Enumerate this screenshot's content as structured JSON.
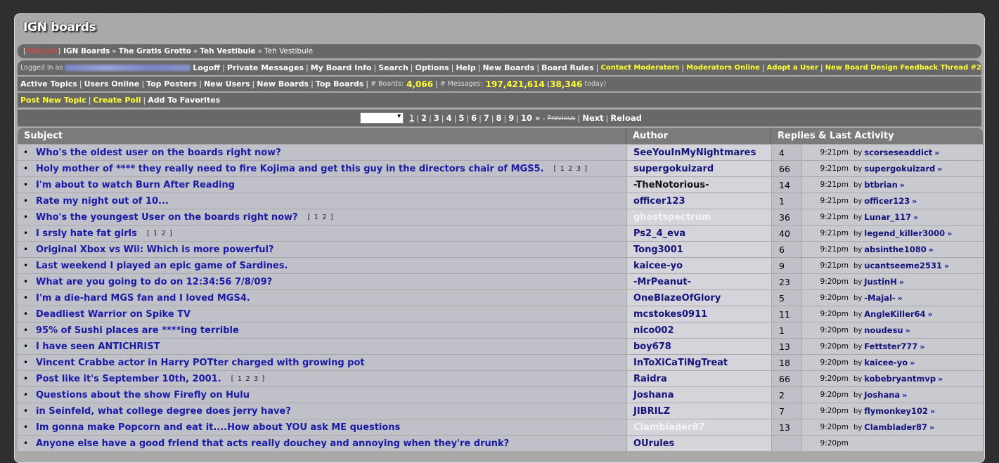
{
  "logo": "IGN boards",
  "breadcrumb": {
    "site": "IGN.com",
    "boards": "IGN Boards",
    "sep": "»",
    "group": "The Gratis Grotto",
    "board": "Teh Vestibule",
    "current": "Teh Vestibule"
  },
  "userbar": {
    "logged_in_as": "Logged in as",
    "items": [
      "Logoff",
      "Private Messages",
      "My Board Info",
      "Search",
      "Options",
      "Help",
      "New Boards",
      "Board Rules"
    ],
    "yellow_items": [
      "Contact Moderators",
      "Moderators Online",
      "Adopt a User",
      "New Board Design Feedback Thread #2"
    ]
  },
  "statsbar": {
    "items": [
      "Active Topics",
      "Users Online",
      "Top Posters",
      "New Users",
      "New Boards",
      "Top Boards"
    ],
    "boards_label": "# Boards:",
    "boards_count": "4,066",
    "messages_label": "# Messages:",
    "messages_count": "197,421,614",
    "today_open": "(",
    "today_count": "38,346",
    "today_label": "today)"
  },
  "actionbar": {
    "post_new_topic": "Post New Topic",
    "create_poll": "Create Poll",
    "add_favorites": "Add To Favorites"
  },
  "pagination": {
    "pages": [
      "1",
      "2",
      "3",
      "4",
      "5",
      "6",
      "7",
      "8",
      "9",
      "10"
    ],
    "more": "»",
    "dash": "-",
    "previous": "Previous",
    "next": "Next",
    "reload": "Reload"
  },
  "table": {
    "headers": {
      "subject": "Subject",
      "author": "Author",
      "replies": "Replies & Last Activity"
    },
    "by_label": "by",
    "arrow": "»",
    "rows": [
      {
        "subject": "Who's the oldest user on the boards right now?",
        "pages": "",
        "author": "SeeYouInMyNightmares",
        "author_style": "",
        "replies": "4",
        "time": "9:21pm",
        "last_user": "scorseseaddict"
      },
      {
        "subject": "Holy mother of **** they really need to fire Kojima and get this guy in the directors chair of MGS5.",
        "pages": "[ 1 2 3 ]",
        "author": "supergokuizard",
        "author_style": "",
        "replies": "66",
        "time": "9:21pm",
        "last_user": "supergokuizard"
      },
      {
        "subject": "I'm about to watch Burn After Reading",
        "pages": "",
        "author": "-TheNotorious-",
        "author_style": "black",
        "replies": "14",
        "time": "9:21pm",
        "last_user": "btbrian"
      },
      {
        "subject": "Rate my night out of 10...",
        "pages": "",
        "author": "officer123",
        "author_style": "",
        "replies": "1",
        "time": "9:21pm",
        "last_user": "officer123"
      },
      {
        "subject": "Who's the youngest User on the boards right now?",
        "pages": "[ 1 2 ]",
        "author": "ghostspectrum",
        "author_style": "white",
        "replies": "36",
        "time": "9:21pm",
        "last_user": "Lunar_117"
      },
      {
        "subject": "I srsly hate fat girls",
        "pages": "[ 1 2 ]",
        "author": "Ps2_4_eva",
        "author_style": "",
        "replies": "40",
        "time": "9:21pm",
        "last_user": "legend_killer3000"
      },
      {
        "subject": "Original Xbox vs Wii: Which is more powerful?",
        "pages": "",
        "author": "Tong3001",
        "author_style": "",
        "replies": "6",
        "time": "9:21pm",
        "last_user": "absinthe1080"
      },
      {
        "subject": "Last weekend I played an epic game of Sardines.",
        "pages": "",
        "author": "kaicee-yo",
        "author_style": "",
        "replies": "9",
        "time": "9:21pm",
        "last_user": "ucantseeme2531"
      },
      {
        "subject": "What are you going to do on 12:34:56 7/8/09?",
        "pages": "",
        "author": "-MrPeanut-",
        "author_style": "",
        "replies": "23",
        "time": "9:20pm",
        "last_user": "JustinH"
      },
      {
        "subject": "I'm a die-hard MGS fan and I loved MGS4.",
        "pages": "",
        "author": "OneBlazeOfGlory",
        "author_style": "",
        "replies": "5",
        "time": "9:20pm",
        "last_user": "-Majal-"
      },
      {
        "subject": "Deadliest Warrior on Spike TV",
        "pages": "",
        "author": "mcstokes0911",
        "author_style": "",
        "replies": "11",
        "time": "9:20pm",
        "last_user": "AngleKiller64"
      },
      {
        "subject": "95% of Sushi places are ****ing terrible",
        "pages": "",
        "author": "nico002",
        "author_style": "",
        "replies": "1",
        "time": "9:20pm",
        "last_user": "noudesu"
      },
      {
        "subject": "I have seen ANTICHRIST",
        "pages": "",
        "author": "boy678",
        "author_style": "",
        "replies": "13",
        "time": "9:20pm",
        "last_user": "Fettster777"
      },
      {
        "subject": "Vincent Crabbe actor in Harry POTter charged with growing pot",
        "pages": "",
        "author": "InToXiCaTiNgTreat",
        "author_style": "",
        "replies": "18",
        "time": "9:20pm",
        "last_user": "kaicee-yo"
      },
      {
        "subject": "Post like it's September 10th, 2001.",
        "pages": "[ 1 2 3 ]",
        "author": "Raidra",
        "author_style": "",
        "replies": "66",
        "time": "9:20pm",
        "last_user": "kobebryantmvp"
      },
      {
        "subject": "Questions about the show Firefly on Hulu",
        "pages": "",
        "author": "Joshana",
        "author_style": "",
        "replies": "2",
        "time": "9:20pm",
        "last_user": "Joshana"
      },
      {
        "subject": "in Seinfeld, what college degree does jerry have?",
        "pages": "",
        "author": "JIBRILZ",
        "author_style": "",
        "replies": "7",
        "time": "9:20pm",
        "last_user": "flymonkey102"
      },
      {
        "subject": "Im gonna make Popcorn and eat it....How about YOU ask ME questions",
        "pages": "",
        "author": "Clamblader87",
        "author_style": "white",
        "replies": "13",
        "time": "9:20pm",
        "last_user": "Clamblader87"
      },
      {
        "subject": "Anyone else have a good friend that acts really douchey and annoying when they're drunk?",
        "pages": "",
        "author": "OUrules",
        "author_style": "",
        "replies": "",
        "time": "9:20pm",
        "last_user": ""
      }
    ]
  }
}
